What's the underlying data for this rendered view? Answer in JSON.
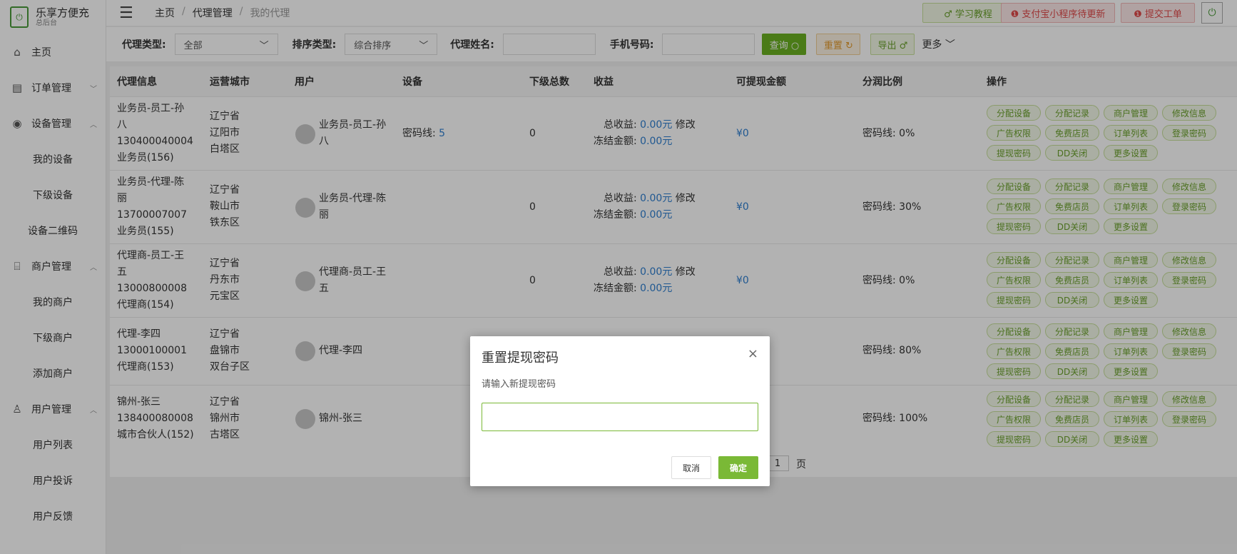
{
  "brand": {
    "name": "乐享方便充",
    "subtitle": "总后台",
    "logo_text": "⏻"
  },
  "sidebar": {
    "home": "主页",
    "orders": "订单管理",
    "devices": "设备管理",
    "device_sub": [
      "我的设备",
      "下级设备",
      "设备二维码"
    ],
    "merchants": "商户管理",
    "merchant_sub": [
      "我的商户",
      "下级商户",
      "添加商户"
    ],
    "users": "用户管理",
    "user_sub": [
      "用户列表",
      "用户投诉",
      "用户反馈"
    ]
  },
  "breadcrumb": {
    "home": "主页",
    "sep1": "/",
    "section": "代理管理",
    "sep2": "/",
    "current": "我的代理"
  },
  "header_buttons": {
    "tutorial": "♂ 学习教程",
    "alipay": "❶ 支付宝小程序待更新",
    "ticket": "❶ 提交工单"
  },
  "filters": {
    "agent_type_label": "代理类型:",
    "agent_type_value": "全部",
    "sort_label": "排序类型:",
    "sort_value": "综合排序",
    "name_label": "代理姓名:",
    "name_value": "",
    "phone_label": "手机号码:",
    "phone_value": "",
    "query_btn": "查询 ○",
    "reset_btn": "重置 ↻",
    "export_btn": "导出 ♂",
    "more": "更多 ﹀"
  },
  "table": {
    "headers": [
      "代理信息",
      "运营城市",
      "用户",
      "设备",
      "下级总数",
      "收益",
      "可提现金额",
      "分润比例",
      "操作"
    ],
    "rows": [
      {
        "info": [
          "业务员-员工-孙",
          "八",
          "130400040004",
          "业务员(156)"
        ],
        "city": [
          "辽宁省",
          "辽阳市",
          "白塔区"
        ],
        "user": [
          "业务员-员工-孙",
          "八"
        ],
        "device_label": "密码线:",
        "device_count": "5",
        "subs": "0",
        "income_label": "总收益:",
        "income": "0.00元",
        "modify": "修改",
        "frozen_label": "冻结金额:",
        "frozen": "0.00元",
        "withdraw": "¥0",
        "ratio": "密码线: 0%"
      },
      {
        "info": [
          "业务员-代理-陈",
          "丽",
          "13700007007",
          "业务员(155)"
        ],
        "city": [
          "辽宁省",
          "鞍山市",
          "铁东区"
        ],
        "user": [
          "业务员-代理-陈",
          "丽"
        ],
        "device_label": "",
        "device_count": "",
        "subs": "0",
        "income_label": "总收益:",
        "income": "0.00元",
        "modify": "修改",
        "frozen_label": "冻结金额:",
        "frozen": "0.00元",
        "withdraw": "¥0",
        "ratio": "密码线: 30%"
      },
      {
        "info": [
          "代理商-员工-王",
          "五",
          "13000800008",
          "代理商(154)"
        ],
        "city": [
          "辽宁省",
          "丹东市",
          "元宝区"
        ],
        "user": [
          "代理商-员工-王",
          "五"
        ],
        "device_label": "",
        "device_count": "",
        "subs": "0",
        "income_label": "总收益:",
        "income": "0.00元",
        "modify": "修改",
        "frozen_label": "冻结金额:",
        "frozen": "0.00元",
        "withdraw": "¥0",
        "ratio": "密码线: 0%"
      },
      {
        "info": [
          "代理-李四",
          "13000100001",
          "代理商(153)"
        ],
        "city": [
          "辽宁省",
          "盘锦市",
          "双台子区"
        ],
        "user": [
          "代理-李四"
        ],
        "ratio": "密码线: 80%"
      },
      {
        "info": [
          "锦州-张三",
          "138400080008",
          "城市合伙人(152)"
        ],
        "city": [
          "辽宁省",
          "锦州市",
          "古塔区"
        ],
        "user": [
          "锦州-张三"
        ],
        "ratio": "密码线: 100%"
      }
    ],
    "ops": [
      "分配设备",
      "分配记录",
      "商户管理",
      "修改信息",
      "广告权限",
      "免费店员",
      "订单列表",
      "登录密码",
      "提现密码",
      "DD关闭",
      "更多设置"
    ]
  },
  "pagination": {
    "page": "1",
    "suffix": "页"
  },
  "modal": {
    "title": "重置提现密码",
    "close": "×",
    "label": "请输入新提现密码",
    "input_value": "",
    "cancel": "取消",
    "confirm": "确定"
  }
}
